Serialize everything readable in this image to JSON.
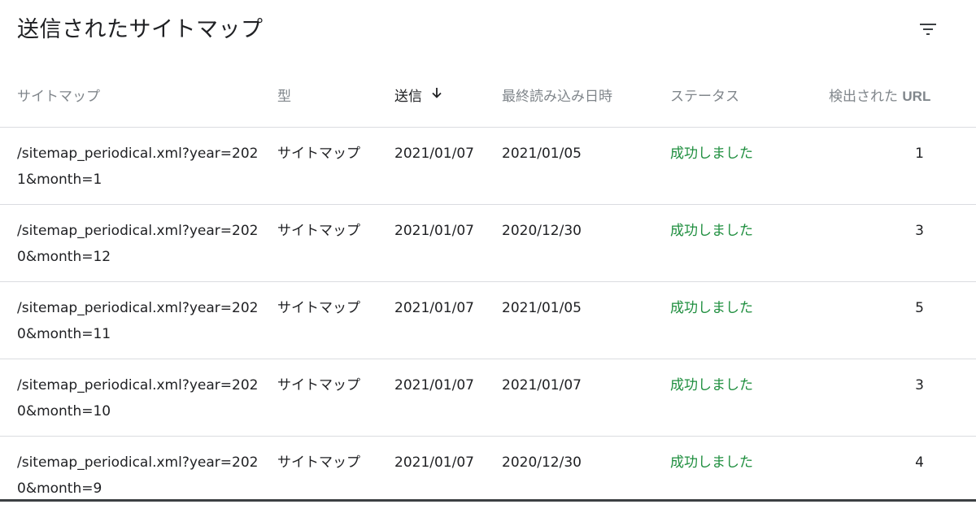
{
  "header": {
    "title": "送信されたサイトマップ",
    "filter_icon": "filter-list-icon"
  },
  "columns": [
    {
      "key": "sitemap",
      "label": "サイトマップ"
    },
    {
      "key": "type",
      "label": "型"
    },
    {
      "key": "sent",
      "label": "送信",
      "sorted": "descending",
      "sort_icon": "arrow-down-icon"
    },
    {
      "key": "last_read",
      "label": "最終読み込み日時"
    },
    {
      "key": "status",
      "label": "ステータス"
    },
    {
      "key": "found_urls",
      "label_prefix": "検出された",
      "label_suffix": "URL"
    }
  ],
  "rows": [
    {
      "sitemap": "/sitemap_periodical.xml?year=2021&month=1",
      "type": "サイトマップ",
      "sent": "2021/01/07",
      "last_read": "2021/01/05",
      "status": "成功しました",
      "found_urls": "1"
    },
    {
      "sitemap": "/sitemap_periodical.xml?year=2020&month=12",
      "type": "サイトマップ",
      "sent": "2021/01/07",
      "last_read": "2020/12/30",
      "status": "成功しました",
      "found_urls": "3"
    },
    {
      "sitemap": "/sitemap_periodical.xml?year=2020&month=11",
      "type": "サイトマップ",
      "sent": "2021/01/07",
      "last_read": "2021/01/05",
      "status": "成功しました",
      "found_urls": "5"
    },
    {
      "sitemap": "/sitemap_periodical.xml?year=2020&month=10",
      "type": "サイトマップ",
      "sent": "2021/01/07",
      "last_read": "2021/01/07",
      "status": "成功しました",
      "found_urls": "3"
    },
    {
      "sitemap": "/sitemap_periodical.xml?year=2020&month=9",
      "type": "サイトマップ",
      "sent": "2021/01/07",
      "last_read": "2020/12/30",
      "status": "成功しました",
      "found_urls": "4"
    }
  ],
  "colors": {
    "status_success": "#1e8e3e",
    "header_text_muted": "#80868b",
    "divider": "#dadce0"
  }
}
